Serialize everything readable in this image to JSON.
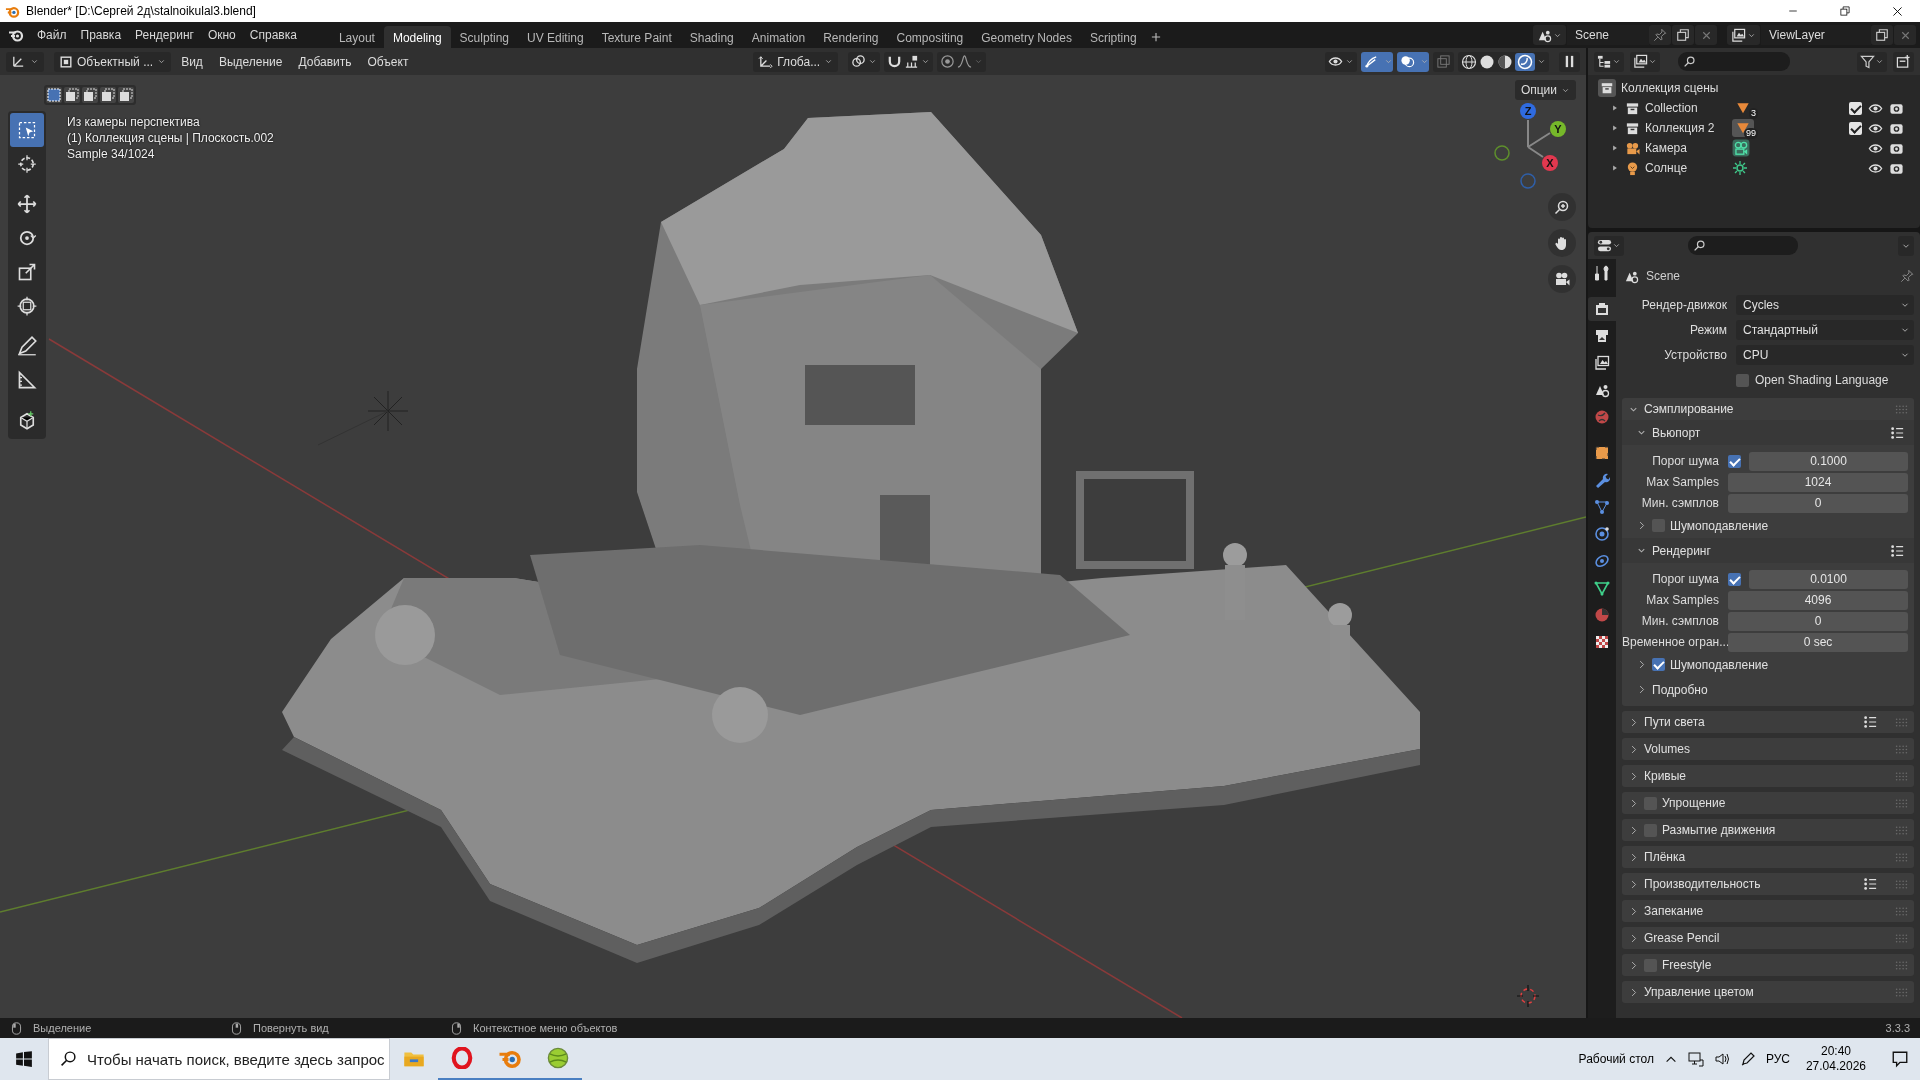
{
  "window": {
    "title": "Blender* [D:\\Сергей 2д\\stalnoikulal3.blend]"
  },
  "menu": [
    "Файл",
    "Правка",
    "Рендеринг",
    "Окно",
    "Справка"
  ],
  "workspaces": [
    {
      "label": "Layout",
      "selected": false
    },
    {
      "label": "Modeling",
      "selected": true
    },
    {
      "label": "Sculpting",
      "selected": false
    },
    {
      "label": "UV Editing",
      "selected": false
    },
    {
      "label": "Texture Paint",
      "selected": false
    },
    {
      "label": "Shading",
      "selected": false
    },
    {
      "label": "Animation",
      "selected": false
    },
    {
      "label": "Rendering",
      "selected": false
    },
    {
      "label": "Compositing",
      "selected": false
    },
    {
      "label": "Geometry Nodes",
      "selected": false
    },
    {
      "label": "Scripting",
      "selected": false
    }
  ],
  "scene": "Scene",
  "view_layer": "ViewLayer",
  "viewport": {
    "toggles": {
      "snap": false,
      "proportional": false,
      "gizmos": true,
      "overlays": true
    },
    "mode": "Объектный ...",
    "menus": [
      "Вид",
      "Выделение",
      "Добавить",
      "Объект"
    ],
    "orientation": "Глоба...",
    "options": "Опции",
    "overlay_lines": [
      "Из камеры перспектива",
      "(1) Коллекция сцены | Плоскость.002",
      "Sample 34/1024"
    ],
    "axes": [
      "X",
      "Y",
      "Z"
    ],
    "tools": [
      {
        "selected": true
      },
      {
        "selected": false
      },
      {
        "selected": false
      },
      {
        "selected": false
      },
      {
        "selected": false
      },
      {
        "selected": false
      },
      {
        "selected": false
      },
      {
        "selected": false
      },
      {
        "selected": false
      }
    ]
  },
  "outliner": {
    "root": "Коллекция сцены",
    "items": [
      {
        "name": "Collection",
        "kind": "collection",
        "badge": "3",
        "checked": true
      },
      {
        "name": "Коллекция 2",
        "kind": "collection",
        "badge": "99",
        "checked": true
      },
      {
        "name": "Камера",
        "kind": "camera"
      },
      {
        "name": "Солнце",
        "kind": "light"
      }
    ]
  },
  "properties": {
    "tabs": [
      {
        "selected": false
      },
      {
        "selected": true
      },
      {
        "selected": false
      },
      {
        "selected": false
      },
      {
        "selected": false
      },
      {
        "selected": false
      },
      {
        "selected": false
      },
      {
        "selected": false
      },
      {
        "selected": false
      },
      {
        "selected": false
      },
      {
        "selected": false
      },
      {
        "selected": false
      },
      {
        "selected": false
      },
      {
        "selected": false
      }
    ],
    "context": "Scene",
    "fields": [
      {
        "label": "Рендер-движок",
        "value": "Cycles"
      },
      {
        "label": "Режим",
        "value": "Стандартный"
      },
      {
        "label": "Устройство",
        "value": "CPU"
      }
    ],
    "osl": {
      "label": "Open Shading Language",
      "checked": false
    },
    "panels": [
      {
        "title": "Сэмплирование",
        "expanded": true,
        "rows": [
          {
            "kind": "group",
            "title": "Вьюпорт",
            "expanded": true,
            "presets": true
          },
          {
            "kind": "field",
            "label": "Порог шума",
            "checked": true,
            "value": "0.1000"
          },
          {
            "kind": "field",
            "label": "Max Samples",
            "value": "1024"
          },
          {
            "kind": "field",
            "label": "Мин. сэмплов",
            "value": "0"
          },
          {
            "kind": "sub",
            "title": "Шумоподавление",
            "expanded": false,
            "checked": false
          },
          {
            "kind": "group",
            "title": "Рендеринг",
            "expanded": true,
            "presets": true
          },
          {
            "kind": "field",
            "label": "Порог шума",
            "checked": true,
            "value": "0.0100"
          },
          {
            "kind": "field",
            "label": "Max Samples",
            "value": "4096"
          },
          {
            "kind": "field",
            "label": "Мин. сэмплов",
            "value": "0"
          },
          {
            "kind": "field",
            "label": "Временное огран...",
            "value": "0 sec"
          },
          {
            "kind": "sub",
            "title": "Шумоподавление",
            "expanded": false,
            "checked": true
          },
          {
            "kind": "sub",
            "title": "Подробно",
            "expanded": false
          }
        ]
      },
      {
        "title": "Пути света",
        "expanded": false,
        "presets": true
      },
      {
        "title": "Volumes",
        "expanded": false
      },
      {
        "title": "Кривые",
        "expanded": false
      },
      {
        "title": "Упрощение",
        "expanded": false,
        "checked": false
      },
      {
        "title": "Размытие движения",
        "expanded": false,
        "checked": false
      },
      {
        "title": "Плёнка",
        "expanded": false
      },
      {
        "title": "Производительность",
        "expanded": false,
        "presets": true
      },
      {
        "title": "Запекание",
        "expanded": false
      },
      {
        "title": "Grease Pencil",
        "expanded": false
      },
      {
        "title": "Freestyle",
        "expanded": false,
        "checked": false
      },
      {
        "title": "Управление цветом",
        "expanded": false
      }
    ]
  },
  "status": {
    "items": [
      "Выделение",
      "Повернуть вид",
      "Контекстное меню объектов"
    ],
    "version": "3.3.3"
  },
  "taskbar": {
    "search_placeholder": "Чтобы начать поиск, введите здесь запрос",
    "desktop": "Рабочий стол",
    "language": "РУС",
    "time": "20:40",
    "date": "27.04.2026"
  }
}
